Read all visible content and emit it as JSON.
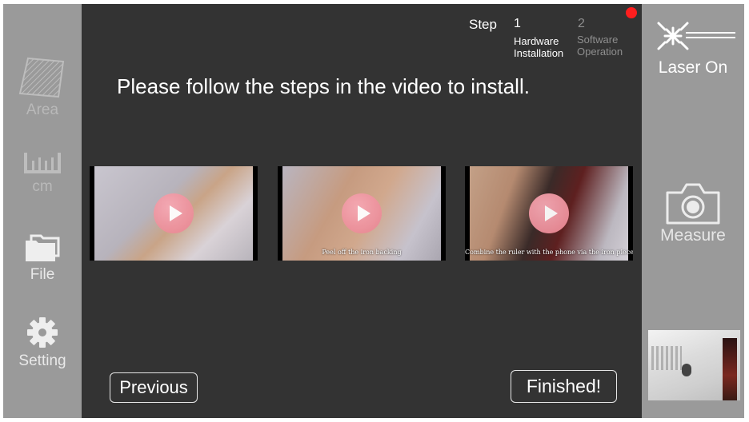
{
  "left_nav": {
    "area_label": "Area",
    "unit_label": "cm",
    "file_label": "File",
    "setting_label": "Setting"
  },
  "steps": {
    "step_word": "Step",
    "step1": {
      "number": "1",
      "label_line1": "Hardware",
      "label_line2": "Installation"
    },
    "step2": {
      "number": "2",
      "label_line1": "Software",
      "label_line2": "Operation"
    }
  },
  "instruction": "Please follow the steps in the video to install.",
  "videos": [
    {
      "caption": ""
    },
    {
      "caption": "Peel off the iron backing"
    },
    {
      "caption": "Combine the ruler with the phone via the iron piece."
    }
  ],
  "buttons": {
    "previous": "Previous",
    "finished": "Finished!"
  },
  "right_nav": {
    "laser_label": "Laser On",
    "measure_label": "Measure"
  },
  "colors": {
    "sidebar": "#9a9a9a",
    "main_bg": "#333333",
    "record_dot": "#ff1e1e",
    "play_button": "#e8838f"
  }
}
